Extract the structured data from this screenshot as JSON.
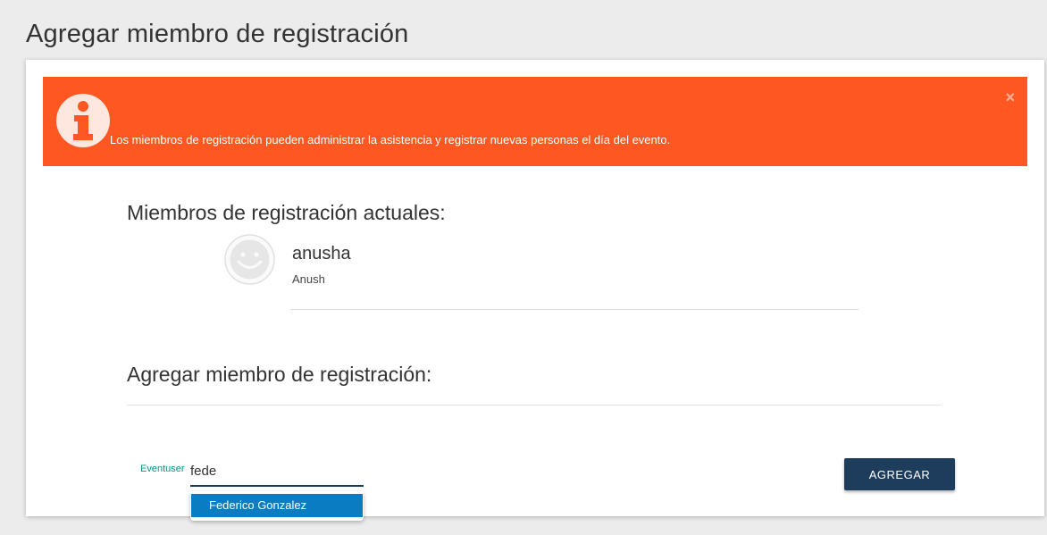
{
  "page": {
    "title": "Agregar miembro de registración"
  },
  "alert": {
    "icon": "info-icon",
    "message": "Los miembros de registración pueden administrar la asistencia y registrar nuevas personas el día del evento.",
    "close_label": "×",
    "color": "#ff5722"
  },
  "current_members": {
    "title": "Miembros de registración actuales:",
    "members": [
      {
        "name": "anusha",
        "subtitle": "Anush",
        "avatar": "smiley-avatar-icon"
      }
    ]
  },
  "add_member": {
    "title": "Agregar miembro de registración:",
    "field_label": "Eventuser",
    "input_value": "fede",
    "suggestions": [
      "Federico Gonzalez"
    ],
    "button_label": "AGREGAR"
  },
  "colors": {
    "accent": "#ff5722",
    "button": "#1e3d5c",
    "suggestion_highlight": "#0a7dc2",
    "label": "#009688"
  }
}
